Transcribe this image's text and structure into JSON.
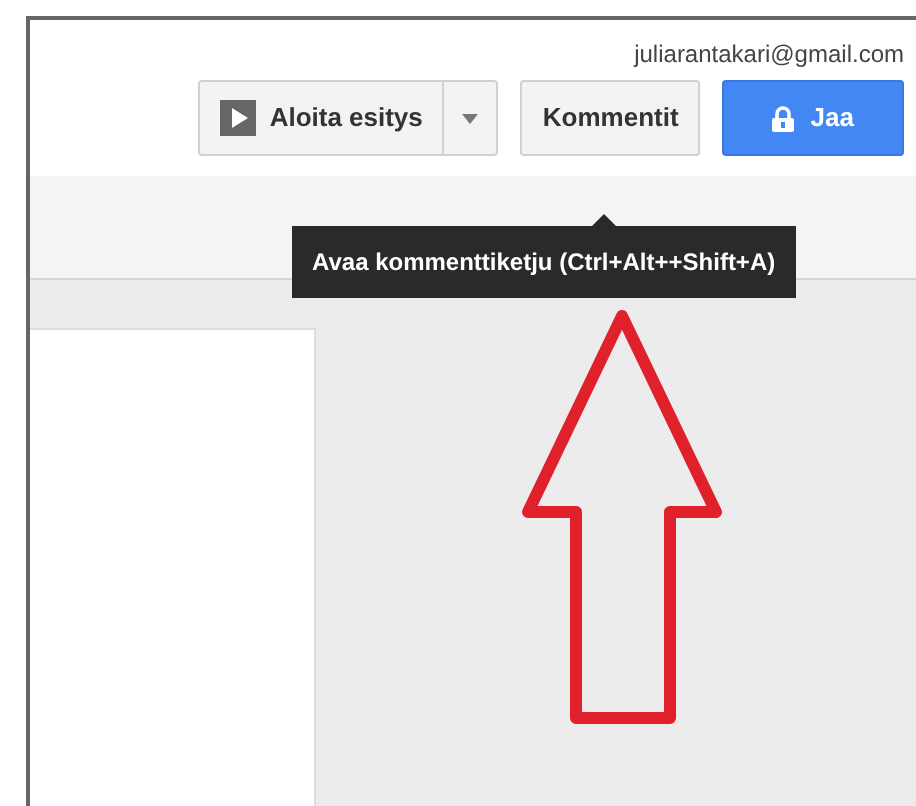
{
  "account": {
    "email": "juliarantakari@gmail.com"
  },
  "buttons": [
    {
      "kind": "present",
      "label": "Aloita esitys"
    },
    {
      "kind": "plain",
      "label": "Kommentit"
    },
    {
      "kind": "share",
      "label": "Jaa"
    }
  ],
  "tooltip": {
    "text": "Avaa kommenttiketju (Ctrl+Alt++Shift+A)"
  }
}
